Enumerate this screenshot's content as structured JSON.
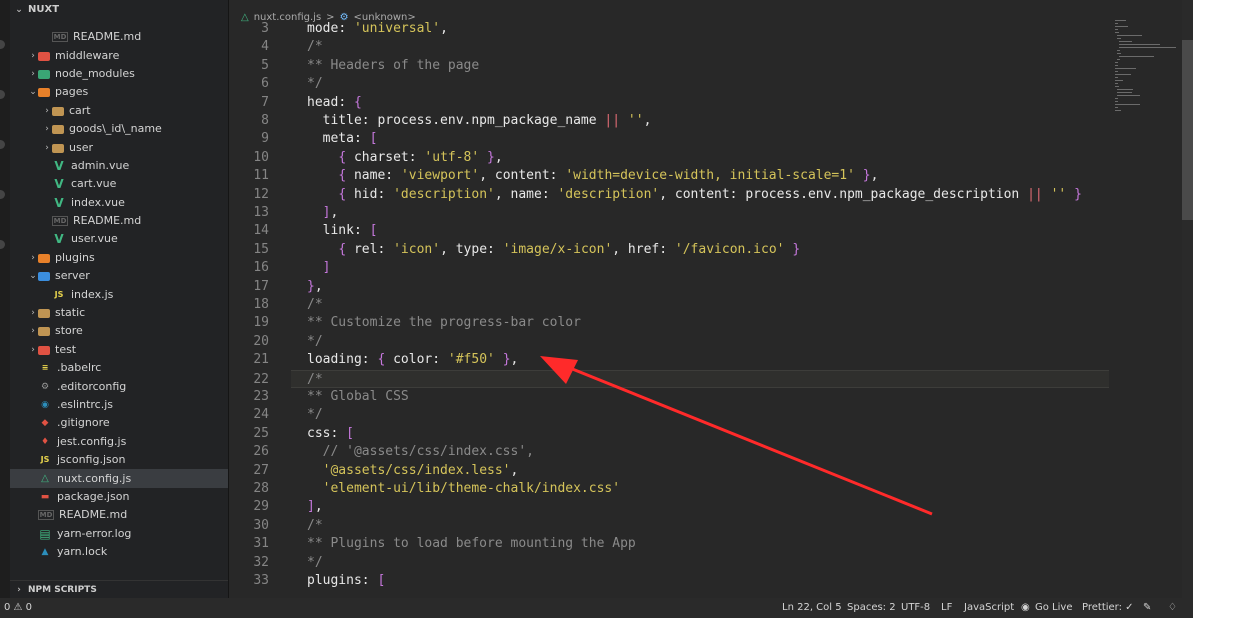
{
  "sidebar": {
    "title": "NUXT",
    "items": [
      {
        "label": "README.md",
        "icon": "md-icon",
        "indent": 2,
        "kind": "file"
      },
      {
        "label": "middleware",
        "icon": "folder-icon",
        "indent": 1,
        "kind": "folder",
        "color": "red"
      },
      {
        "label": "node_modules",
        "icon": "folder-icon",
        "indent": 1,
        "kind": "folder",
        "color": "green"
      },
      {
        "label": "pages",
        "icon": "folder-icon",
        "indent": 1,
        "kind": "folder-open",
        "color": "orange"
      },
      {
        "label": "cart",
        "icon": "folder-icon",
        "indent": 2,
        "kind": "folder"
      },
      {
        "label": "goods\\_id\\_name",
        "icon": "folder-icon",
        "indent": 2,
        "kind": "folder"
      },
      {
        "label": "user",
        "icon": "folder-icon",
        "indent": 2,
        "kind": "folder"
      },
      {
        "label": "admin.vue",
        "icon": "vue-icon",
        "indent": 2,
        "kind": "file"
      },
      {
        "label": "cart.vue",
        "icon": "vue-icon",
        "indent": 2,
        "kind": "file"
      },
      {
        "label": "index.vue",
        "icon": "vue-icon",
        "indent": 2,
        "kind": "file"
      },
      {
        "label": "README.md",
        "icon": "md-icon",
        "indent": 2,
        "kind": "file"
      },
      {
        "label": "user.vue",
        "icon": "vue-icon",
        "indent": 2,
        "kind": "file"
      },
      {
        "label": "plugins",
        "icon": "folder-icon",
        "indent": 1,
        "kind": "folder",
        "color": "orange"
      },
      {
        "label": "server",
        "icon": "folder-icon",
        "indent": 1,
        "kind": "folder-open",
        "color": "blue"
      },
      {
        "label": "index.js",
        "icon": "js-icon",
        "indent": 2,
        "kind": "file"
      },
      {
        "label": "static",
        "icon": "folder-icon",
        "indent": 1,
        "kind": "folder"
      },
      {
        "label": "store",
        "icon": "folder-icon",
        "indent": 1,
        "kind": "folder"
      },
      {
        "label": "test",
        "icon": "folder-icon",
        "indent": 1,
        "kind": "folder",
        "color": "red"
      },
      {
        "label": ".babelrc",
        "icon": "babel-icon",
        "indent": 1,
        "kind": "file"
      },
      {
        "label": ".editorconfig",
        "icon": "gear-icon",
        "indent": 1,
        "kind": "file"
      },
      {
        "label": ".eslintrc.js",
        "icon": "eslint-icon",
        "indent": 1,
        "kind": "file"
      },
      {
        "label": ".gitignore",
        "icon": "git-icon",
        "indent": 1,
        "kind": "file"
      },
      {
        "label": "jest.config.js",
        "icon": "jest-icon",
        "indent": 1,
        "kind": "file"
      },
      {
        "label": "jsconfig.json",
        "icon": "js-icon",
        "indent": 1,
        "kind": "file"
      },
      {
        "label": "nuxt.config.js",
        "icon": "nuxt-icon",
        "indent": 1,
        "kind": "file",
        "selected": true
      },
      {
        "label": "package.json",
        "icon": "npm-icon",
        "indent": 1,
        "kind": "file"
      },
      {
        "label": "README.md",
        "icon": "md-icon",
        "indent": 1,
        "kind": "file"
      },
      {
        "label": "yarn-error.log",
        "icon": "log-icon",
        "indent": 1,
        "kind": "file"
      },
      {
        "label": "yarn.lock",
        "icon": "yarn-icon",
        "indent": 1,
        "kind": "file"
      }
    ],
    "bottom_section": "NPM SCRIPTS"
  },
  "breadcrumb": {
    "file": "nuxt.config.js",
    "separator": ">",
    "symbol": "<unknown>"
  },
  "code_lines": [
    {
      "n": "3",
      "text": "mode: 'universal',"
    },
    {
      "n": "4",
      "text": "/*"
    },
    {
      "n": "5",
      "text": "** Headers of the page"
    },
    {
      "n": "6",
      "text": "*/"
    },
    {
      "n": "7",
      "text": "head: {"
    },
    {
      "n": "8",
      "text": "  title: process.env.npm_package_name || '',"
    },
    {
      "n": "9",
      "text": "  meta: ["
    },
    {
      "n": "10",
      "text": "    { charset: 'utf-8' },"
    },
    {
      "n": "11",
      "text": "    { name: 'viewport', content: 'width=device-width, initial-scale=1' },"
    },
    {
      "n": "12",
      "text": "    { hid: 'description', name: 'description', content: process.env.npm_package_description || '' }"
    },
    {
      "n": "13",
      "text": "  ],"
    },
    {
      "n": "14",
      "text": "  link: ["
    },
    {
      "n": "15",
      "text": "    { rel: 'icon', type: 'image/x-icon', href: '/favicon.ico' }"
    },
    {
      "n": "16",
      "text": "  ]"
    },
    {
      "n": "17",
      "text": "},"
    },
    {
      "n": "18",
      "text": "/*"
    },
    {
      "n": "19",
      "text": "** Customize the progress-bar color"
    },
    {
      "n": "20",
      "text": "*/"
    },
    {
      "n": "21",
      "text": "loading: { color: '#f50' },"
    },
    {
      "n": "22",
      "text": "/*",
      "active": true
    },
    {
      "n": "23",
      "text": "** Global CSS"
    },
    {
      "n": "24",
      "text": "*/"
    },
    {
      "n": "25",
      "text": "css: ["
    },
    {
      "n": "26",
      "text": "  // '@assets/css/index.css',"
    },
    {
      "n": "27",
      "text": "  '@assets/css/index.less',"
    },
    {
      "n": "28",
      "text": "  'element-ui/lib/theme-chalk/index.css'"
    },
    {
      "n": "29",
      "text": "],"
    },
    {
      "n": "30",
      "text": "/*"
    },
    {
      "n": "31",
      "text": "** Plugins to load before mounting the App"
    },
    {
      "n": "32",
      "text": "*/"
    },
    {
      "n": "33",
      "text": "plugins: ["
    }
  ],
  "statusbar": {
    "problems": "0 ⚠ 0",
    "position": "Ln 22, Col 5",
    "spaces": "Spaces: 2",
    "encoding": "UTF-8",
    "eol": "LF",
    "language": "JavaScript",
    "golive": "Go Live",
    "prettier": "Prettier: ✓"
  },
  "colors": {
    "keyword": "#f0a050",
    "string": "#d5c45a",
    "comment": "#8a8a8a",
    "bracket": "#c678dd",
    "annotation_arrow": "#ff2a2a"
  }
}
